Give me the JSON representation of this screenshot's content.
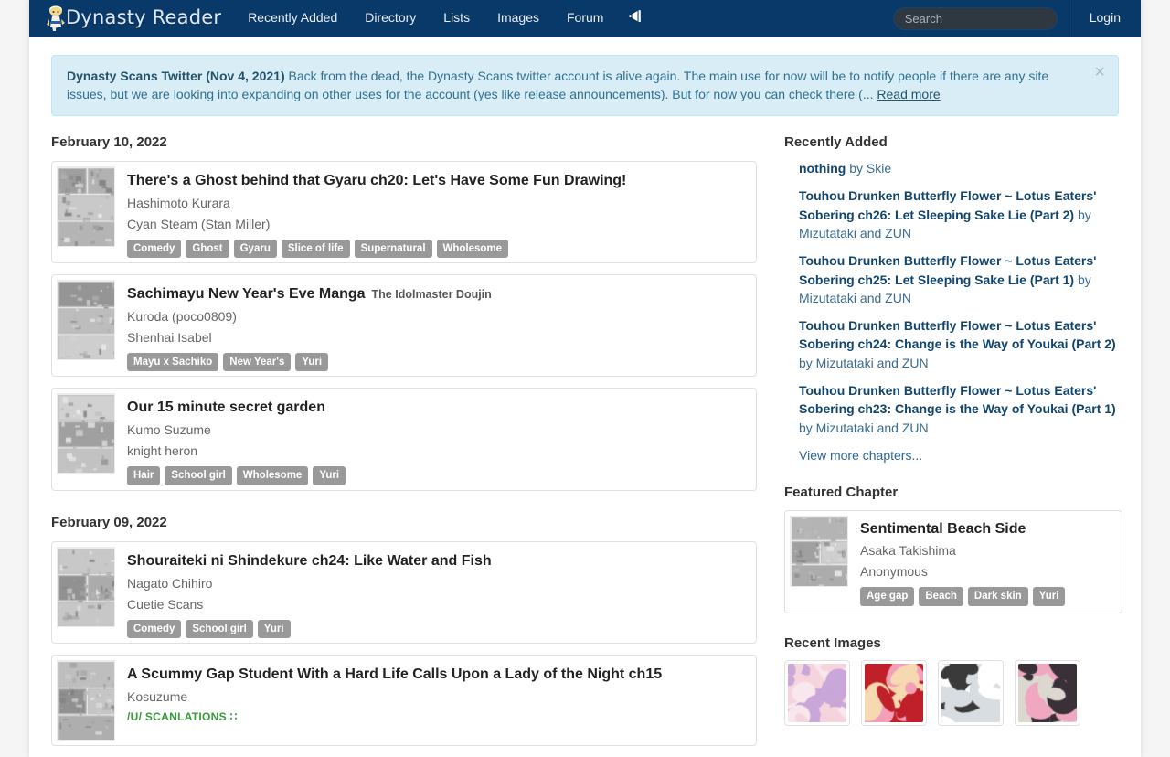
{
  "site": {
    "brand": "Dynasty Reader",
    "brand_icon": "mascot-icon"
  },
  "nav": {
    "items": [
      {
        "label": "Recently Added",
        "name": "nav-recently-added"
      },
      {
        "label": "Directory",
        "name": "nav-directory"
      },
      {
        "label": "Lists",
        "name": "nav-lists"
      },
      {
        "label": "Images",
        "name": "nav-images"
      },
      {
        "label": "Forum",
        "name": "nav-forum"
      }
    ],
    "announce_icon": "megaphone-icon",
    "search_placeholder": "Search",
    "search_value": "",
    "login_label": "Login"
  },
  "alert": {
    "title": "Dynasty Scans Twitter (Nov 4, 2021)",
    "body": "Back from the dead, the Dynasty Scans twitter account is alive again. The main use for now will be to notify people if there are any site issues, but we are looking into expanding on other uses for the account (yes like release announcements). But for now you can check there (...",
    "read_more": "Read more",
    "close_icon": "×",
    "bg_color": "#d9edf7",
    "text_color": "#31708f"
  },
  "main": {
    "groups": [
      {
        "date": "February 10, 2022",
        "entries": [
          {
            "title": "There's a Ghost behind that Gyaru ch20: Let's Have Some Fun Drawing!",
            "subtitle": "",
            "author": "Hashimoto Kurara",
            "scanlator": "Cyan Steam (Stan Miller)",
            "scanlator_style": "normal",
            "tags": [
              "Comedy",
              "Ghost",
              "Gyaru",
              "Slice of life",
              "Supernatural",
              "Wholesome"
            ]
          },
          {
            "title": "Sachimayu New Year's Eve Manga",
            "subtitle": "The Idolmaster Doujin",
            "author": "Kuroda (poco0809)",
            "scanlator": "Shenhai Isabel",
            "scanlator_style": "normal",
            "tags": [
              "Mayu x Sachiko",
              "New Year's",
              "Yuri"
            ]
          },
          {
            "title": "Our 15 minute secret garden",
            "subtitle": "",
            "author": "Kumo Suzume",
            "scanlator": "knight heron",
            "scanlator_style": "normal",
            "tags": [
              "Hair",
              "School girl",
              "Wholesome",
              "Yuri"
            ]
          }
        ]
      },
      {
        "date": "February 09, 2022",
        "entries": [
          {
            "title": "Shouraiteki ni Shindekure ch24: Like Water and Fish",
            "subtitle": "",
            "author": "Nagato Chihiro",
            "scanlator": "Cuetie Scans",
            "scanlator_style": "normal",
            "tags": [
              "Comedy",
              "School girl",
              "Yuri"
            ]
          },
          {
            "title": "A Scummy Gap Student With a Hard Life Calls Upon a Lady of the Night ch15",
            "subtitle": "",
            "author": "Kosuzume",
            "scanlator": "/U/ SCANLATIONS ∷",
            "scanlator_style": "green",
            "tags": []
          }
        ]
      }
    ]
  },
  "sidebar": {
    "recently_added_title": "Recently Added",
    "recently_added": [
      {
        "title": "nothing",
        "by": " by Skie"
      },
      {
        "title": "Touhou Drunken Butterfly Flower ~ Lotus Eaters' Sobering ch26: Let Sleeping Sake Lie (Part 2)",
        "by": " by Mizutataki and ZUN"
      },
      {
        "title": "Touhou Drunken Butterfly Flower ~ Lotus Eaters' Sobering ch25: Let Sleeping Sake Lie (Part 1)",
        "by": " by Mizutataki and ZUN"
      },
      {
        "title": "Touhou Drunken Butterfly Flower ~ Lotus Eaters' Sobering ch24: Change is the Way of Youkai (Part 2)",
        "by": " by Mizutataki and ZUN"
      },
      {
        "title": "Touhou Drunken Butterfly Flower ~ Lotus Eaters' Sobering ch23: Change is the Way of Youkai (Part 1)",
        "by": " by Mizutataki and ZUN"
      }
    ],
    "view_more": "View more chapters...",
    "featured_title": "Featured Chapter",
    "featured": {
      "title": "Sentimental Beach Side",
      "author": "Asaka Takishima",
      "scanlator": "Anonymous",
      "tags": [
        "Age gap",
        "Beach",
        "Dark skin",
        "Yuri"
      ]
    },
    "recent_images_title": "Recent Images",
    "recent_images_count": 4
  },
  "colors": {
    "navbar": "#083968",
    "link": "#11456e",
    "tag": "#999999",
    "page_bg": "#f5f5f5"
  }
}
